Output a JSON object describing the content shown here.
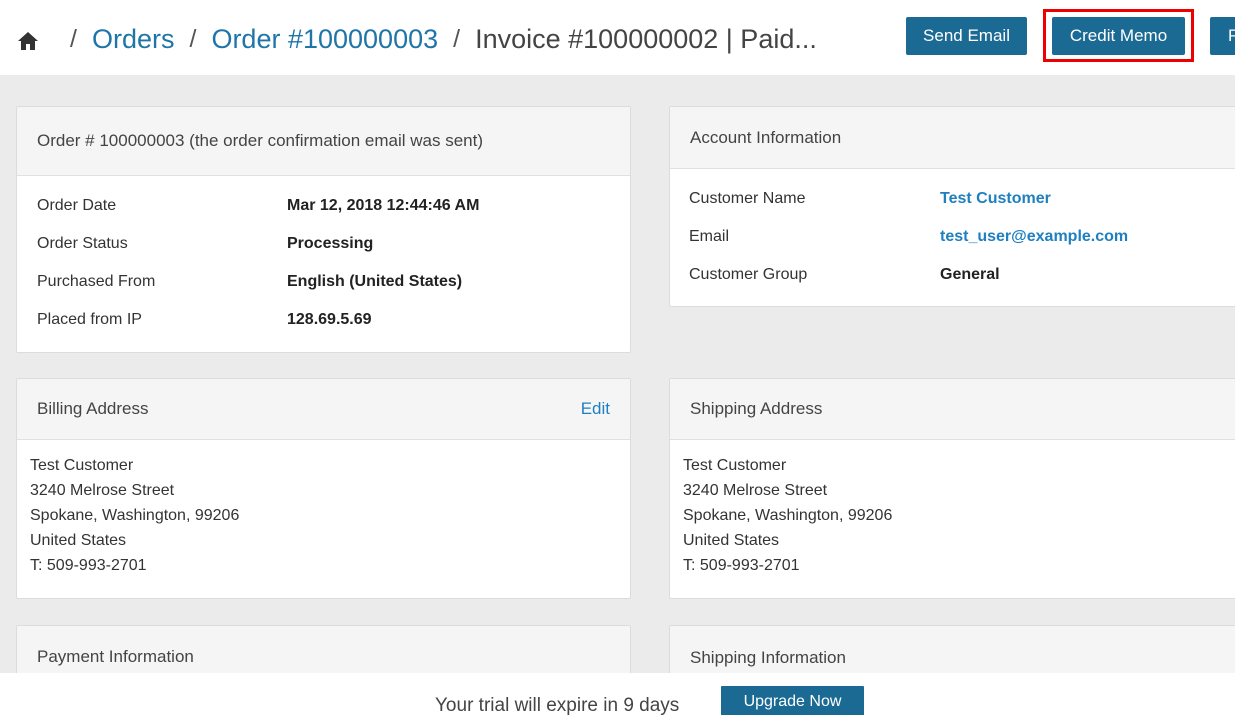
{
  "breadcrumb": {
    "home_icon": "home-icon",
    "separator": "/",
    "items": [
      "Orders",
      "Order #100000003"
    ],
    "current": "Invoice #100000002 | Paid..."
  },
  "actions": {
    "send_email": "Send Email",
    "credit_memo": "Credit Memo",
    "partial": "P"
  },
  "order_panel": {
    "title": "Order # 100000003 (the order confirmation email was sent)",
    "rows": [
      {
        "label": "Order Date",
        "value": "Mar 12, 2018 12:44:46 AM"
      },
      {
        "label": "Order Status",
        "value": "Processing"
      },
      {
        "label": "Purchased From",
        "value": "English (United States)"
      },
      {
        "label": "Placed from IP",
        "value": "128.69.5.69"
      }
    ]
  },
  "account_panel": {
    "title": "Account Information",
    "rows": [
      {
        "label": "Customer Name",
        "value": "Test Customer"
      },
      {
        "label": "Email",
        "value": "test_user@example.com"
      },
      {
        "label": "Customer Group",
        "value": "General"
      }
    ]
  },
  "billing_panel": {
    "title": "Billing Address",
    "edit": "Edit",
    "lines": [
      "Test Customer",
      "3240 Melrose Street",
      "Spokane, Washington, 99206",
      "United States",
      "T: 509-993-2701"
    ]
  },
  "shipping_panel": {
    "title": "Shipping Address",
    "lines": [
      "Test Customer",
      "3240 Melrose Street",
      "Spokane, Washington, 99206",
      "United States",
      "T: 509-993-2701"
    ]
  },
  "payment_panel": {
    "title": "Payment Information"
  },
  "shipping_info_panel": {
    "title": "Shipping Information"
  },
  "trial": {
    "text": "Your trial will expire in 9 days",
    "button": "Upgrade Now"
  },
  "colors": {
    "button_bg": "#1a6a94",
    "link": "#1f80c0",
    "highlight": "#e00000"
  }
}
